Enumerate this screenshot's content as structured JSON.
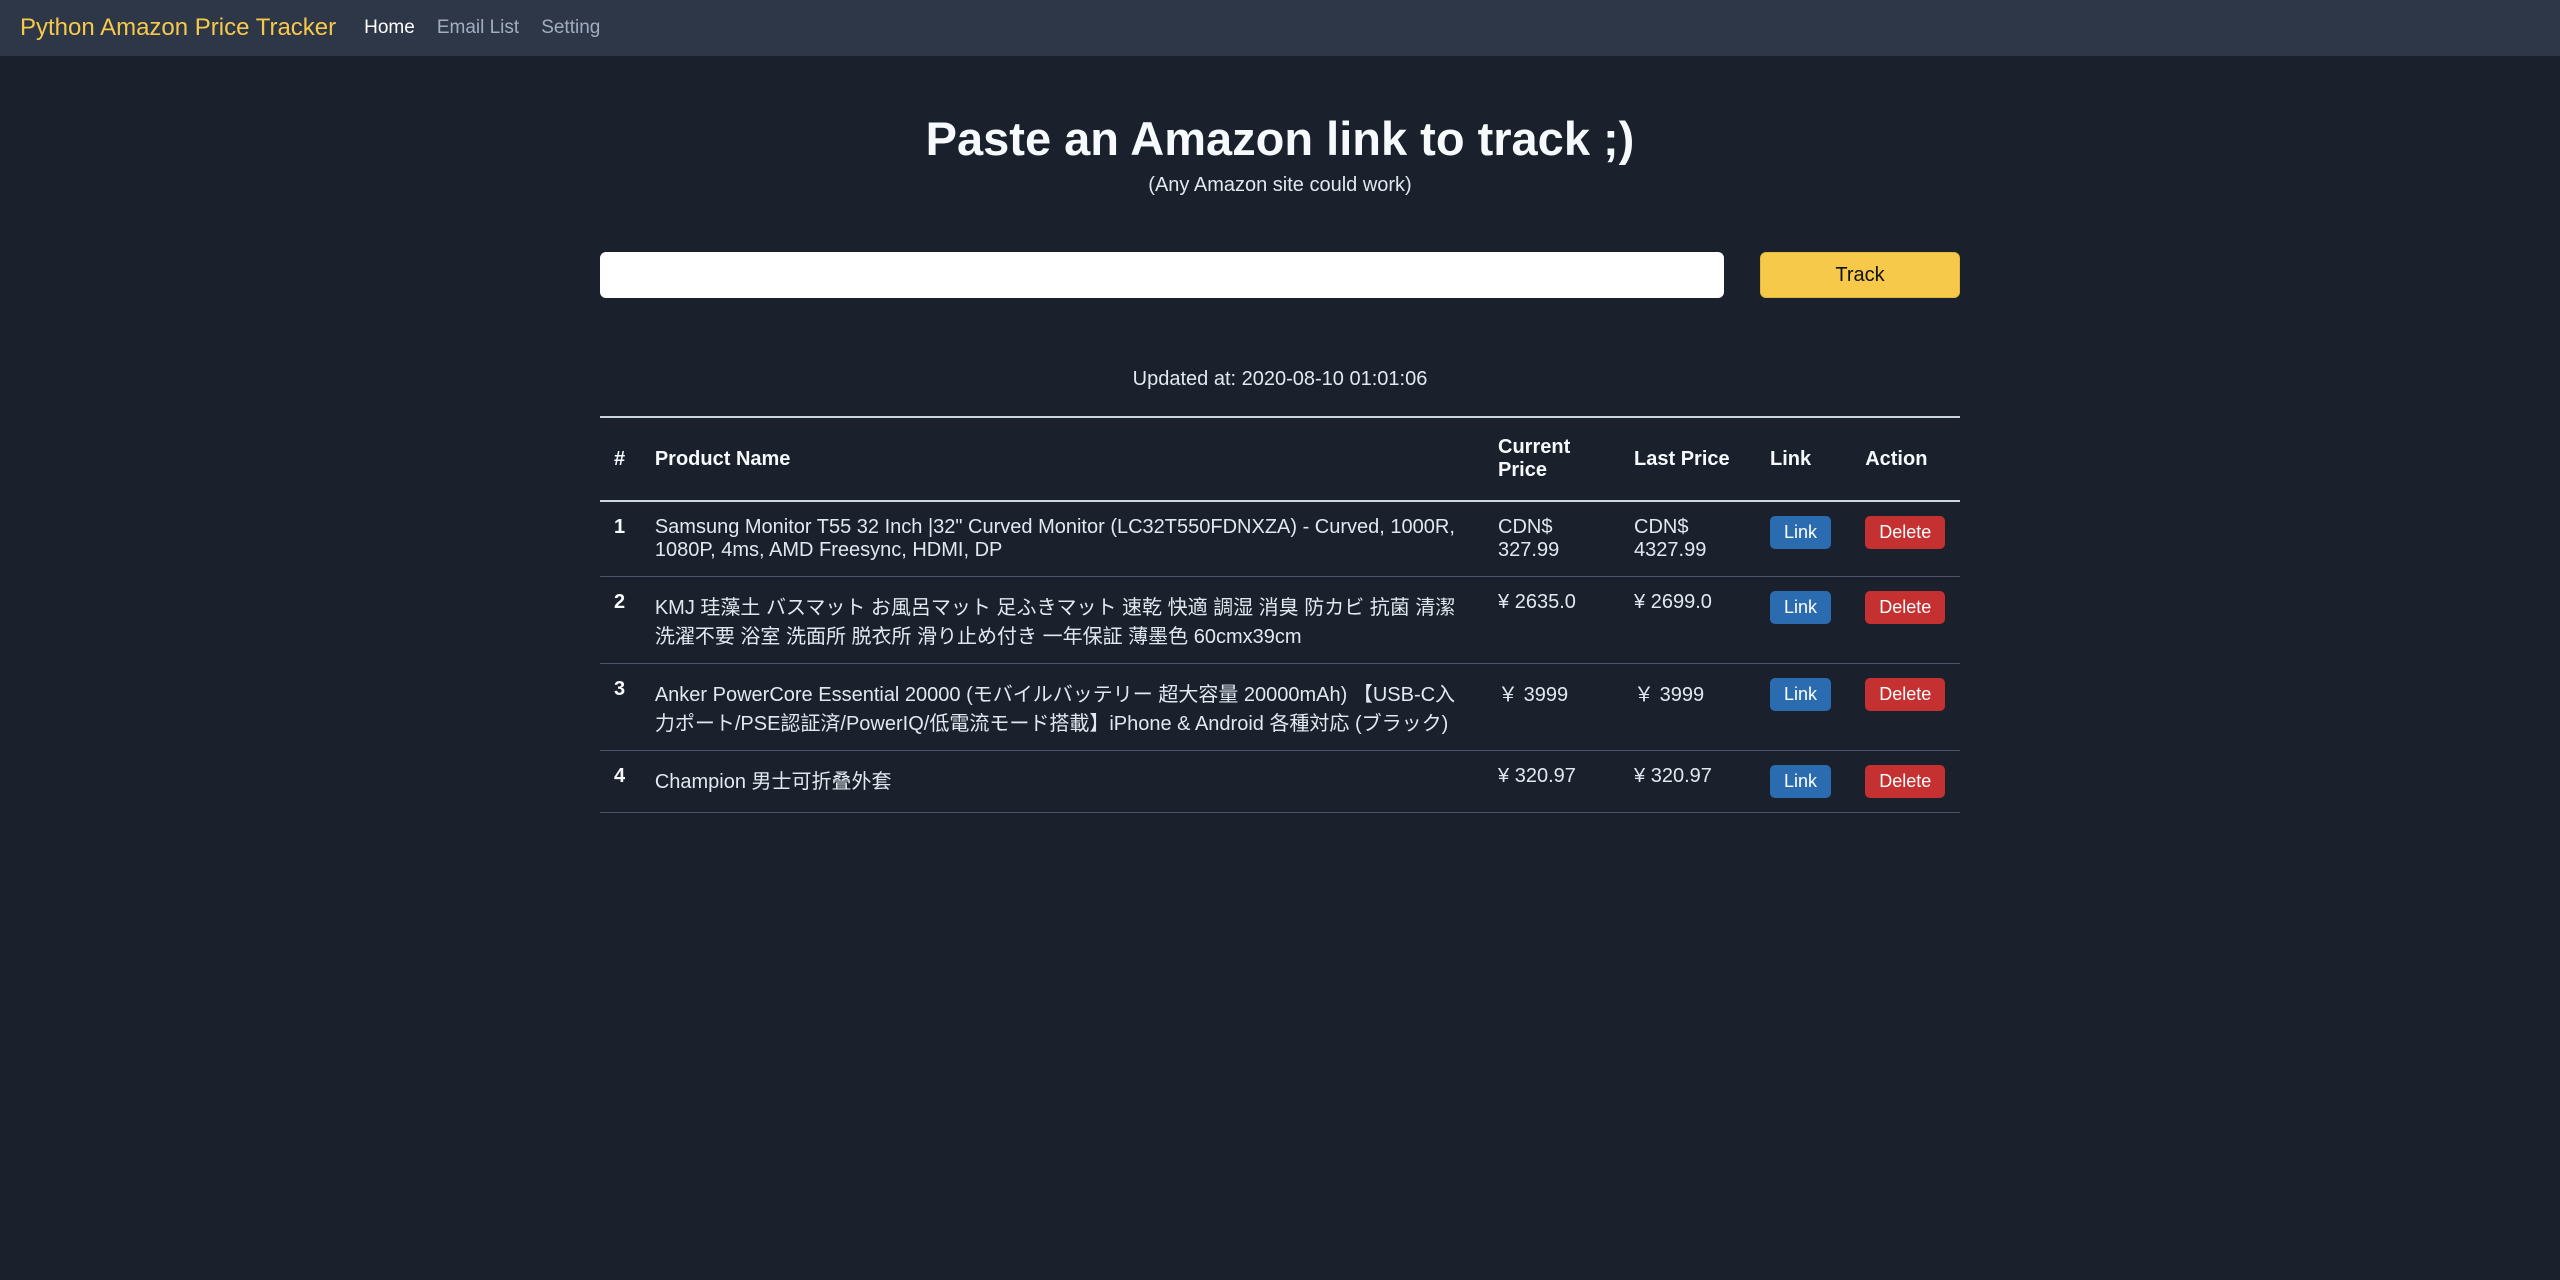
{
  "brand": "Python Amazon Price Tracker",
  "nav": {
    "home": "Home",
    "email_list": "Email List",
    "setting": "Setting"
  },
  "hero": {
    "title": "Paste an Amazon link to track ;)",
    "subtitle": "(Any Amazon site could work)"
  },
  "form": {
    "url_value": "",
    "track_label": "Track"
  },
  "updated_label": "Updated at: 2020-08-10 01:01:06",
  "table": {
    "headers": {
      "index": "#",
      "name": "Product Name",
      "current": "Current Price",
      "last": "Last Price",
      "link": "Link",
      "action": "Action"
    },
    "link_label": "Link",
    "delete_label": "Delete",
    "rows": [
      {
        "idx": "1",
        "name": "Samsung Monitor T55 32 Inch |32\" Curved Monitor (LC32T550FDNXZA) - Curved, 1000R, 1080P, 4ms, AMD Freesync, HDMI, DP",
        "current": "CDN$ 327.99",
        "last": "CDN$ 4327.99"
      },
      {
        "idx": "2",
        "name": "KMJ 珪藻土 バスマット お風呂マット 足ふきマット 速乾 快適 調湿 消臭 防カビ 抗菌 清潔 洗濯不要 浴室 洗面所 脱衣所 滑り止め付き 一年保証 薄墨色 60cmx39cm",
        "current": "¥ 2635.0",
        "last": "¥ 2699.0"
      },
      {
        "idx": "3",
        "name": "Anker PowerCore Essential 20000 (モバイルバッテリー 超大容量 20000mAh) 【USB-C入力ポート/PSE認証済/PowerIQ/低電流モード搭載】iPhone & Android 各種対応 (ブラック)",
        "current": "￥ 3999",
        "last": "￥ 3999"
      },
      {
        "idx": "4",
        "name": "Champion 男士可折叠外套",
        "current": "¥ 320.97",
        "last": "¥ 320.97"
      }
    ]
  }
}
